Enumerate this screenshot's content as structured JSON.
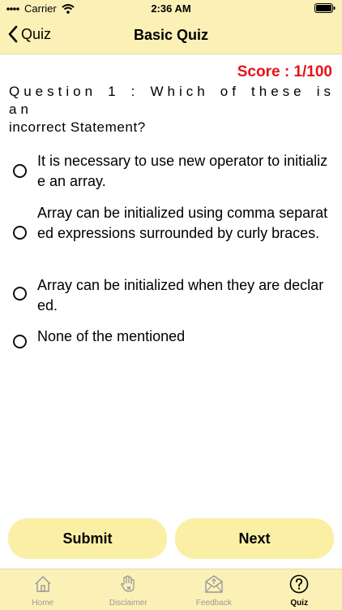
{
  "status": {
    "carrier": "Carrier",
    "time": "2:36 AM"
  },
  "nav": {
    "back_label": "Quiz",
    "title": "Basic Quiz"
  },
  "quiz": {
    "score": "Score : 1/100",
    "question_line1": "Question 1 : Which of these is an",
    "question_line2": "incorrect Statement?",
    "options": [
      " It is necessary to use new operator to initialize an array.",
      "Array can be initialized using comma separated expressions surrounded by curly braces.",
      " Array can be initialized when they are declared.",
      " None of the mentioned"
    ]
  },
  "actions": {
    "submit_label": "Submit",
    "next_label": "Next"
  },
  "tabs": [
    {
      "label": "Home",
      "icon": "home-icon"
    },
    {
      "label": "Disclaimer",
      "icon": "hand-icon"
    },
    {
      "label": "Feedback",
      "icon": "mail-icon"
    },
    {
      "label": "Quiz",
      "icon": "question-icon",
      "active": true
    }
  ],
  "colors": {
    "bar_bg": "#fbf1b7",
    "button_bg": "#fbefa6",
    "score_red": "#e8111a",
    "inactive_tab": "#9a9a9a"
  }
}
